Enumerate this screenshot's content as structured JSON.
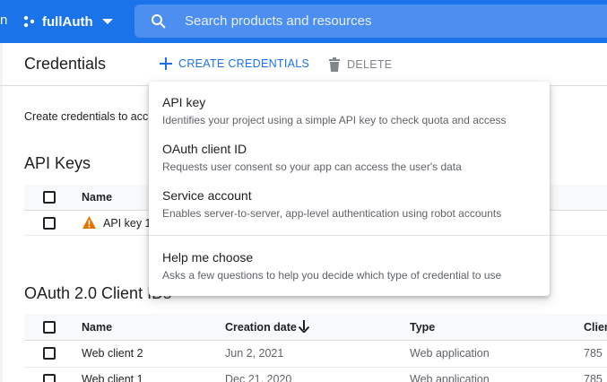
{
  "topbar": {
    "edge_char": "n",
    "project_name": "fullAuth",
    "search_placeholder": "Search products and resources",
    "color": "#1a73e8"
  },
  "header": {
    "title": "Credentials",
    "create_label": "CREATE CREDENTIALS",
    "delete_label": "DELETE"
  },
  "intro_text": "Create credentials to acc",
  "api_keys": {
    "title": "API Keys",
    "columns": [
      "Name"
    ],
    "rows": [
      {
        "name": "API key 1",
        "warning_icon": "warning-icon"
      }
    ]
  },
  "oauth": {
    "title": "OAuth 2.0 Client IDs",
    "columns": [
      "Name",
      "Creation date",
      "Type",
      "Clien"
    ],
    "rows": [
      {
        "name": "Web client 2",
        "date": "Jun 2, 2021",
        "type": "Web application",
        "client": "785"
      },
      {
        "name": "Web client 1",
        "date": "Dec 21, 2020",
        "type": "Web application",
        "client": "785"
      }
    ]
  },
  "menu": {
    "items": [
      {
        "title": "API key",
        "desc": "Identifies your project using a simple API key to check quota and access"
      },
      {
        "title": "OAuth client ID",
        "desc": "Requests user consent so your app can access the user's data"
      },
      {
        "title": "Service account",
        "desc": "Enables server-to-server, app-level authentication using robot accounts"
      },
      {
        "title": "Help me choose",
        "desc": "Asks a few questions to help you decide which type of credential to use"
      }
    ]
  }
}
